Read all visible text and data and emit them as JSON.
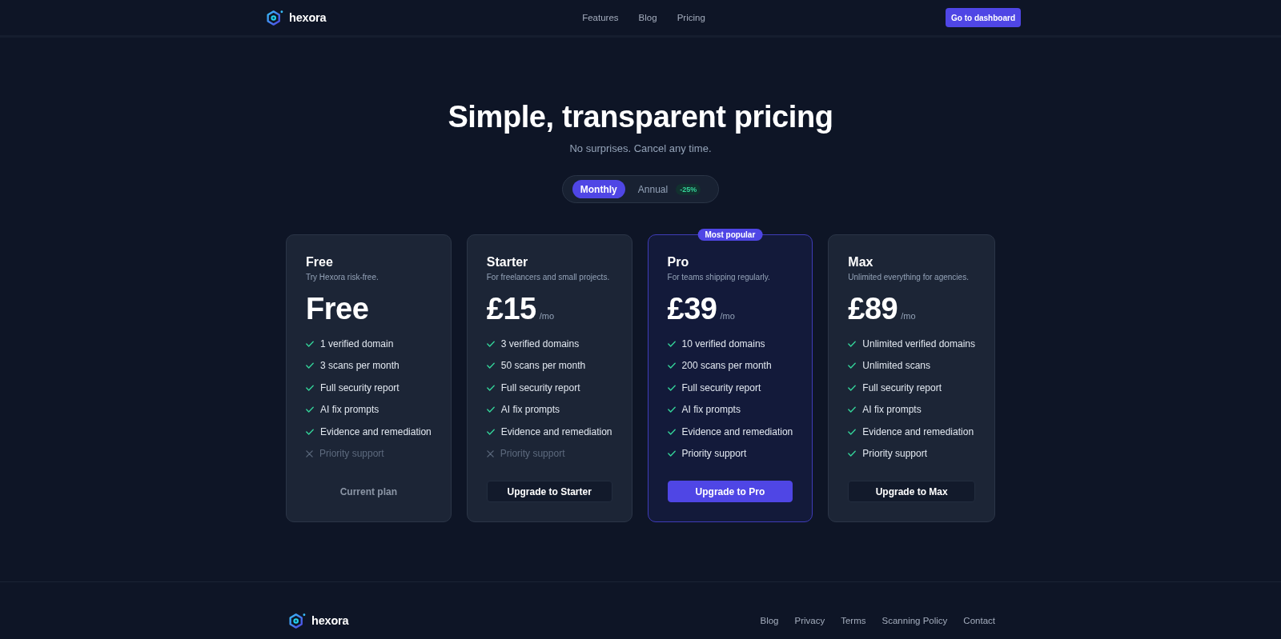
{
  "header": {
    "brand": "hexora",
    "nav": [
      {
        "label": "Features"
      },
      {
        "label": "Blog"
      },
      {
        "label": "Pricing"
      }
    ],
    "cta": "Go to dashboard"
  },
  "hero": {
    "title": "Simple, transparent pricing",
    "subtitle": "No surprises. Cancel any time."
  },
  "billing_toggle": [
    {
      "label": "Monthly",
      "selected": true
    },
    {
      "label": "Annual",
      "selected": false,
      "badge": "-25%"
    }
  ],
  "plans": [
    {
      "name": "Free",
      "description": "Try Hexora risk-free.",
      "price": "Free",
      "featured": false,
      "features": [
        {
          "label": "1 verified domain",
          "included": true
        },
        {
          "label": "3 scans per month",
          "included": true
        },
        {
          "label": "Full security report",
          "included": true
        },
        {
          "label": "AI fix prompts",
          "included": true
        },
        {
          "label": "Evidence and remediation",
          "included": true
        },
        {
          "label": "Priority support",
          "included": false
        }
      ],
      "button": {
        "label": "Current plan",
        "kind": "current"
      }
    },
    {
      "name": "Starter",
      "description": "For freelancers and small projects.",
      "price": "£15",
      "period": "/mo",
      "featured": false,
      "features": [
        {
          "label": "3 verified domains",
          "included": true
        },
        {
          "label": "50 scans per month",
          "included": true
        },
        {
          "label": "Full security report",
          "included": true
        },
        {
          "label": "AI fix prompts",
          "included": true
        },
        {
          "label": "Evidence and remediation",
          "included": true
        },
        {
          "label": "Priority support",
          "included": false
        }
      ],
      "button": {
        "label": "Upgrade to Starter",
        "kind": "outline"
      }
    },
    {
      "name": "Pro",
      "description": "For teams shipping regularly.",
      "price": "£39",
      "period": "/mo",
      "featured": true,
      "badge": "Most popular",
      "features": [
        {
          "label": "10 verified domains",
          "included": true
        },
        {
          "label": "200 scans per month",
          "included": true
        },
        {
          "label": "Full security report",
          "included": true
        },
        {
          "label": "AI fix prompts",
          "included": true
        },
        {
          "label": "Evidence and remediation",
          "included": true
        },
        {
          "label": "Priority support",
          "included": true
        }
      ],
      "button": {
        "label": "Upgrade to Pro",
        "kind": "primary"
      }
    },
    {
      "name": "Max",
      "description": "Unlimited everything for agencies.",
      "price": "£89",
      "period": "/mo",
      "featured": false,
      "features": [
        {
          "label": "Unlimited verified domains",
          "included": true
        },
        {
          "label": "Unlimited scans",
          "included": true
        },
        {
          "label": "Full security report",
          "included": true
        },
        {
          "label": "AI fix prompts",
          "included": true
        },
        {
          "label": "Evidence and remediation",
          "included": true
        },
        {
          "label": "Priority support",
          "included": true
        }
      ],
      "button": {
        "label": "Upgrade to Max",
        "kind": "outline"
      }
    }
  ],
  "footer": {
    "brand": "hexora",
    "links": [
      {
        "label": "Blog"
      },
      {
        "label": "Privacy"
      },
      {
        "label": "Terms"
      },
      {
        "label": "Scanning Policy"
      },
      {
        "label": "Contact"
      }
    ]
  }
}
